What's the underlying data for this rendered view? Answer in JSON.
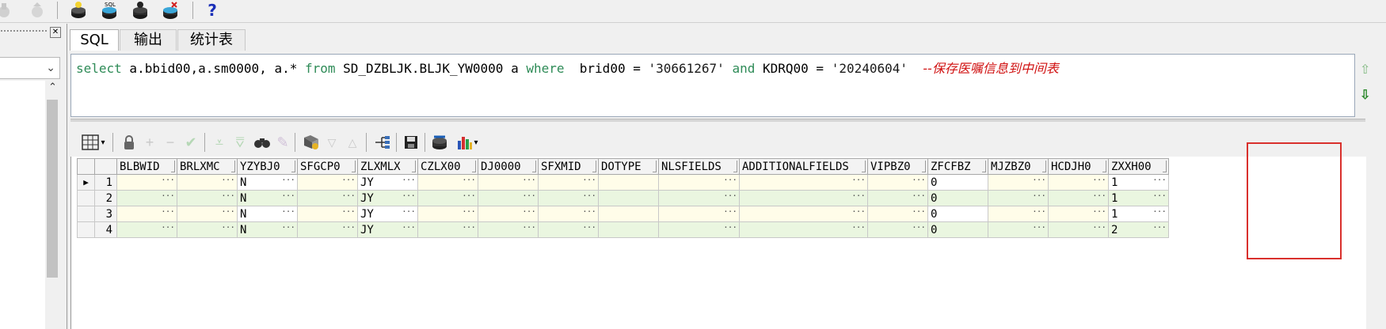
{
  "toolbar": {
    "help_label": "?"
  },
  "tabs": [
    {
      "label": "SQL"
    },
    {
      "label": "输出"
    },
    {
      "label": "统计表"
    }
  ],
  "sql": {
    "kw_select": "select",
    "part1": " a.bbid00,a.sm0000, a.* ",
    "kw_from": "from",
    "part2": " SD_DZBLJK.BLJK_YW0000 a ",
    "kw_where": "where",
    "part3": "  brid00 = ",
    "lit1": "'30661267'",
    "part4": " ",
    "kw_and": "and",
    "part5": " KDRQ00 = ",
    "lit2": "'20240604'",
    "part6": "  ",
    "comment": "--保存医嘱信息到中间表"
  },
  "grid": {
    "columns": [
      "BLBWID",
      "BRLXMC",
      "YZYBJ0",
      "SFGCP0",
      "ZLXMLX",
      "CZLX00",
      "DJ0000",
      "SFXMID",
      "DOTYPE",
      "NLSFIELDS",
      "ADDITIONALFIELDS",
      "VIPBZ0",
      "ZFCFBZ",
      "MJZBZ0",
      "HCDJH0",
      "ZXXH00"
    ],
    "rows": [
      {
        "num": "1",
        "cells": [
          "",
          "",
          "N",
          "",
          "JY",
          "",
          "",
          "",
          "",
          "",
          "",
          "",
          "0",
          "",
          "",
          "1"
        ]
      },
      {
        "num": "2",
        "cells": [
          "",
          "",
          "N",
          "",
          "JY",
          "",
          "",
          "",
          "",
          "",
          "",
          "",
          "0",
          "",
          "",
          "1"
        ]
      },
      {
        "num": "3",
        "cells": [
          "",
          "",
          "N",
          "",
          "JY",
          "",
          "",
          "",
          "",
          "",
          "",
          "",
          "0",
          "",
          "",
          "1"
        ]
      },
      {
        "num": "4",
        "cells": [
          "",
          "",
          "N",
          "",
          "JY",
          "",
          "",
          "",
          "",
          "",
          "",
          "",
          "0",
          "",
          "",
          "2"
        ]
      }
    ]
  },
  "colors": {
    "keyword": "#2e8b57",
    "comment": "#d01010",
    "highlight_box": "#d9302c",
    "row_even": "#eaf6e0",
    "row_odd": "#fffde9"
  }
}
